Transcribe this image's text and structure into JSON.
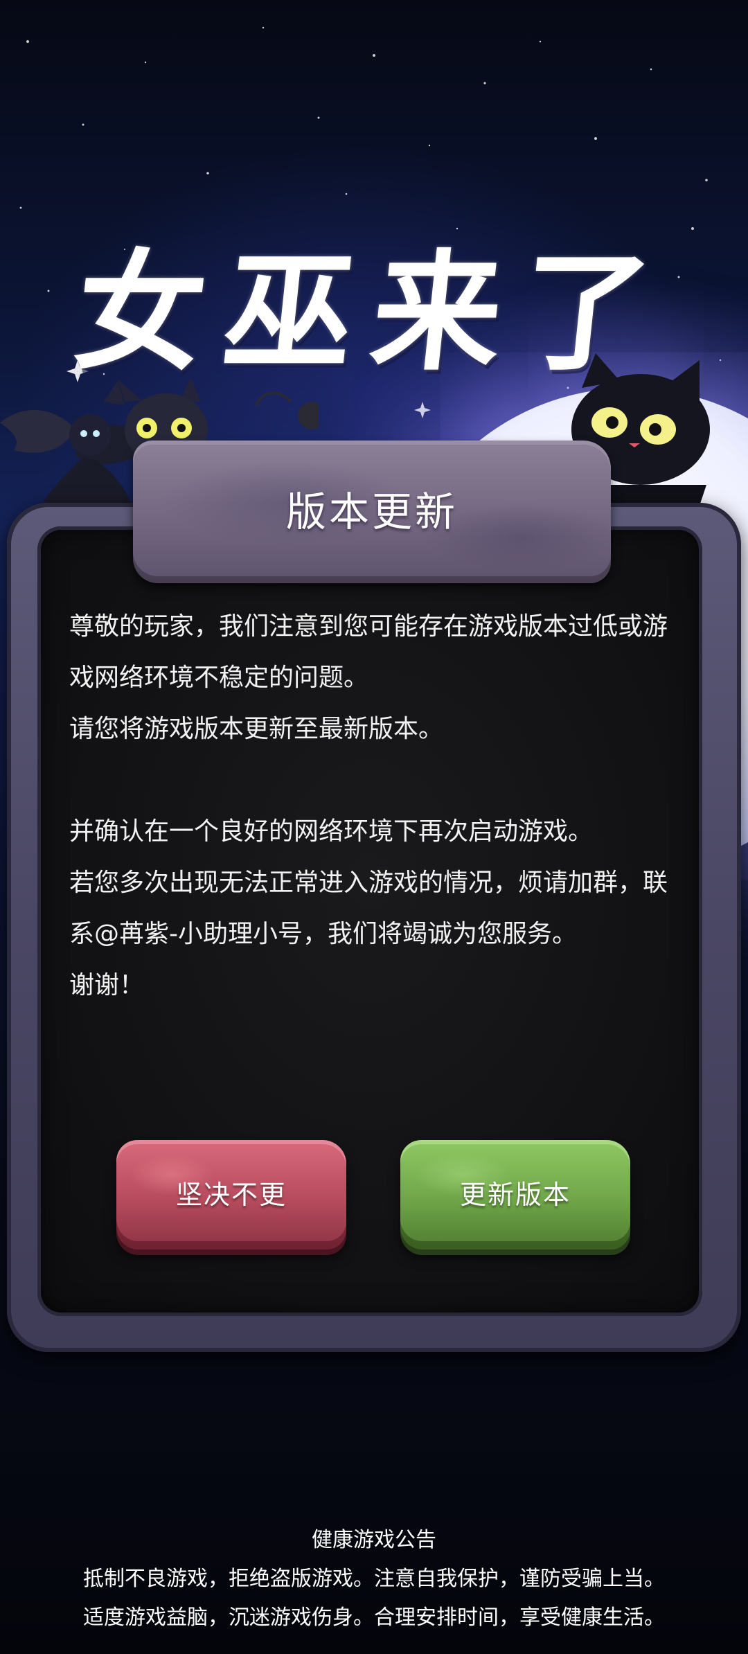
{
  "game": {
    "title": "女巫来了"
  },
  "dialog": {
    "title": "版本更新",
    "message_lines": [
      "尊敬的玩家，我们注意到您可能存在游戏版本过低或游戏网络环境不稳定的问题。",
      "请您将游戏版本更新至最新版本。",
      "并确认在一个良好的网络环境下再次启动游戏。",
      "若您多次出现无法正常进入游戏的情况，烦请加群，联系@苒紫-小助理小号，我们将竭诚为您服务。",
      "谢谢！"
    ],
    "decline_button": "坚决不更",
    "update_button": "更新版本"
  },
  "health_notice": {
    "title": "健康游戏公告",
    "line1": "抵制不良游戏，拒绝盗版游戏。注意自我保护，谨防受骗上当。",
    "line2": "适度游戏益脑，沉迷游戏伤身。合理安排时间，享受健康生活。"
  },
  "colors": {
    "decline": "#b64b5d",
    "update": "#6fa548",
    "panel": "#121214",
    "plank": "#736781"
  }
}
